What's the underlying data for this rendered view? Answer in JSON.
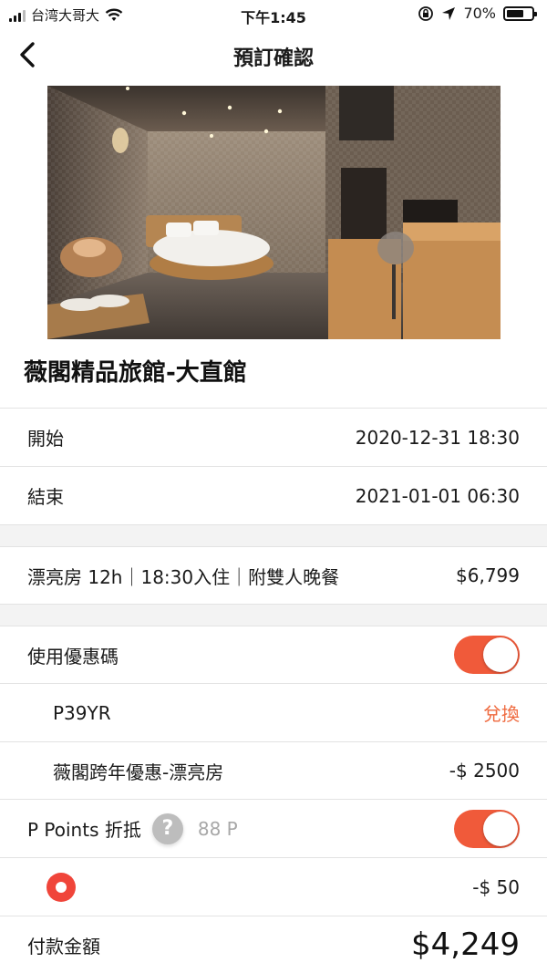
{
  "status_bar": {
    "carrier": "台湾大哥大",
    "time": "下午1:45",
    "battery": "70%",
    "battery_level": 0.7
  },
  "nav": {
    "title": "預訂確認",
    "back_icon": "chevron-left-icon"
  },
  "hotel": {
    "name": "薇閣精品旅館-大直館"
  },
  "schedule": {
    "start_label": "開始",
    "start_value": "2020-12-31 18:30",
    "end_label": "結束",
    "end_value": "2021-01-01 06:30"
  },
  "room": {
    "description": "漂亮房 12h｜18:30入住｜附雙人晚餐",
    "price": "$6,799"
  },
  "coupon": {
    "label": "使用優惠碼",
    "enabled": true,
    "code": "P39YR",
    "redeem_label": "兌換",
    "promo_name": "薇閣跨年優惠-漂亮房",
    "promo_discount": "-$ 2500"
  },
  "points": {
    "label": "P Points 折抵",
    "help_icon": "?",
    "balance": "88 P",
    "enabled": true,
    "discount": "-$ 50"
  },
  "payment": {
    "label": "付款金額",
    "total": "$4,249"
  },
  "colors": {
    "accent": "#f05a3a",
    "orange_text": "#ef6a3f",
    "radio": "#f0453a"
  }
}
